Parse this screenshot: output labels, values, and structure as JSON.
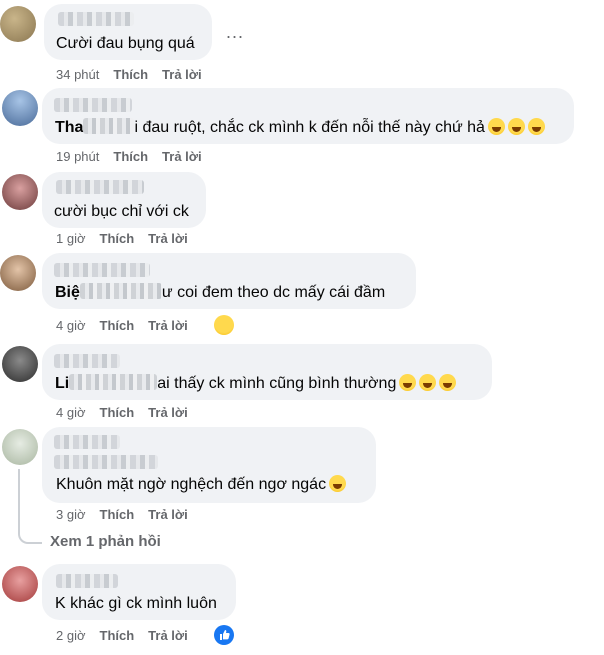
{
  "comments": [
    {
      "segments": [
        "Cười đau bụng quá"
      ],
      "time": "34 phút",
      "like": "Thích",
      "reply": "Trả lời",
      "more": "..."
    },
    {
      "segments": [
        "Tha",
        "i đau ruột, chắc ck mình k đến nỗi thế này chứ hả"
      ],
      "time": "19 phút",
      "like": "Thích",
      "reply": "Trả lời"
    },
    {
      "segments": [
        "cười bục chỉ với ck"
      ],
      "time": "1 giờ",
      "like": "Thích",
      "reply": "Trả lời"
    },
    {
      "segments": [
        "Biệ",
        "ư coi đem theo dc mấy cái đầm"
      ],
      "time": "4 giờ",
      "like": "Thích",
      "reply": "Trả lời"
    },
    {
      "segments": [
        "Li",
        "ai thấy ck mình cũng bình thường"
      ],
      "time": "4 giờ",
      "like": "Thích",
      "reply": "Trả lời"
    },
    {
      "segments": [
        "Khuôn mặt ngờ nghệch đến ngơ ngác"
      ],
      "time": "3 giờ",
      "like": "Thích",
      "reply": "Trả lời",
      "view_replies": "Xem 1 phản hồi"
    },
    {
      "segments": [
        "K khác gì ck mình luôn"
      ],
      "time": "2 giờ",
      "like": "Thích",
      "reply": "Trả lời"
    }
  ],
  "colors": {
    "bubble": "#f0f2f5",
    "meta": "#65676b",
    "like_blue": "#1877f2",
    "emoji_yellow": "#ffd94d"
  },
  "icons": [
    "laughing-emoji",
    "rofl-emoji",
    "like-reaction-icon",
    "more-options-icon"
  ]
}
